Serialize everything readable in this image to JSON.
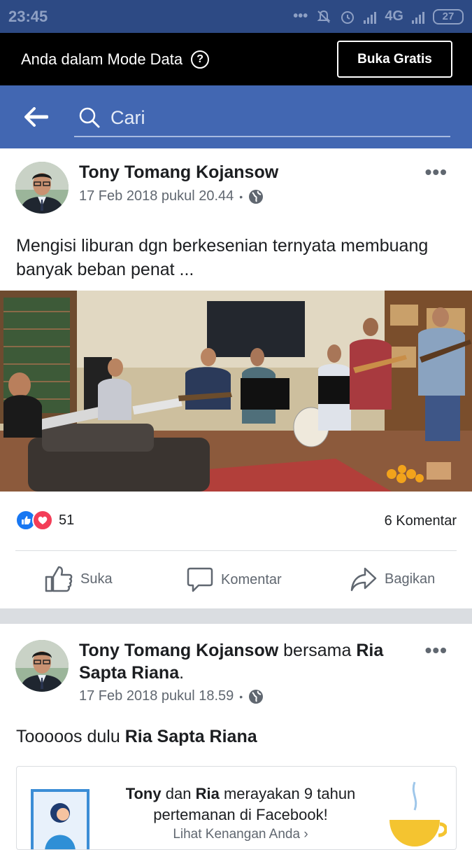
{
  "status_bar": {
    "time": "23:45",
    "network": "4G",
    "battery": "27"
  },
  "data_banner": {
    "text": "Anda dalam Mode Data",
    "help": "?",
    "button": "Buka Gratis"
  },
  "nav": {
    "search_placeholder": "Cari"
  },
  "post1": {
    "author": "Tony Tomang Kojansow",
    "timestamp": "17 Feb 2018 pukul 20.44",
    "dot": "•",
    "text": "Mengisi liburan dgn berkesenian ternyata membuang banyak beban penat ...",
    "reaction_count": "51",
    "comment_count": "6 Komentar",
    "actions": {
      "like": "Suka",
      "comment": "Komentar",
      "share": "Bagikan"
    }
  },
  "post2": {
    "author": "Tony Tomang Kojansow",
    "with_word": "bersama",
    "tagged": "Ria Sapta Riana",
    "period": ".",
    "timestamp": "17 Feb 2018 pukul 18.59",
    "dot": "•",
    "text_prefix": "Tooooos dulu",
    "text_tag": "Ria Sapta Riana",
    "memory": {
      "name1": "Tony",
      "and": "dan",
      "name2": "Ria",
      "line": "merayakan 9 tahun pertemanan di Facebook!",
      "link": "Lihat Kenangan Anda"
    }
  },
  "colors": {
    "fb_blue": "#4267b2",
    "statusbar": "#2d4a84",
    "like_blue": "#1877f2",
    "love_red": "#f33e58"
  }
}
